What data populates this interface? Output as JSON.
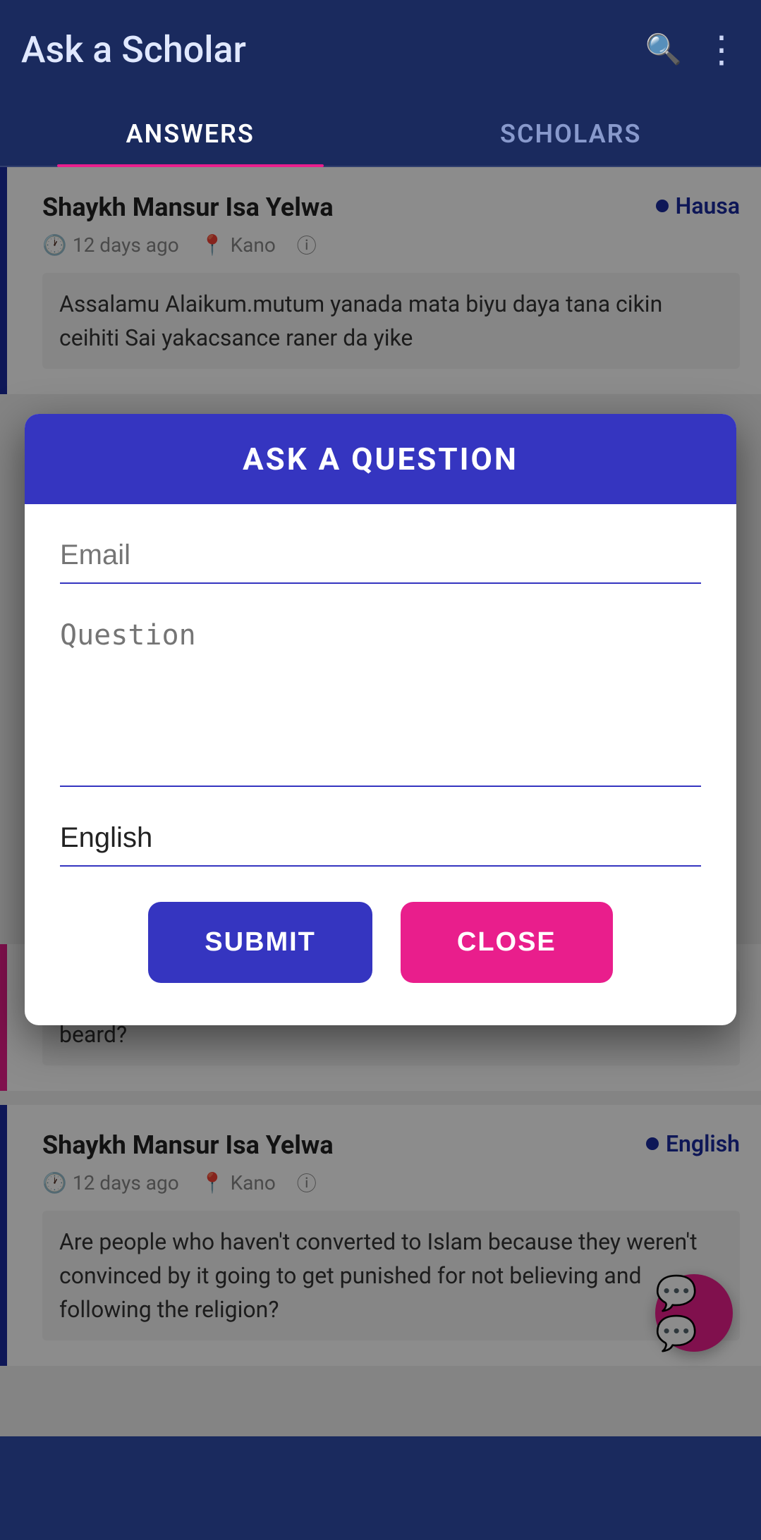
{
  "header": {
    "title": "Ask a Scholar",
    "search_icon": "search-icon",
    "menu_icon": "more-options-icon"
  },
  "tabs": [
    {
      "label": "ANSWERS",
      "active": true
    },
    {
      "label": "SCHOLARS",
      "active": false
    }
  ],
  "cards": [
    {
      "author": "Shaykh Mansur Isa Yelwa",
      "language": "Hausa",
      "time": "12 days ago",
      "location": "Kano",
      "body": "Assalamu Alaikum.mutum yanada mata biyu daya tana cikin ceihiti Sai yakacsance raner da yike",
      "border_color": "blue"
    },
    {
      "author": "",
      "language": "",
      "time": "",
      "location": "",
      "body": "Salaam Alaikum. Is it permissible for a young man to dye his black beard?",
      "border_color": "pink"
    },
    {
      "author": "Shaykh Mansur Isa Yelwa",
      "language": "English",
      "time": "12 days ago",
      "location": "Kano",
      "body": "Are people who haven't converted to Islam because they weren't convinced by it going to get punished for not believing and following the religion?",
      "border_color": "blue"
    }
  ],
  "modal": {
    "title": "ASK A QUESTION",
    "email_placeholder": "Email",
    "question_placeholder": "Question",
    "language_value": "English",
    "submit_label": "SUBMIT",
    "close_label": "CLOSE"
  },
  "fab": {
    "icon": "chat-icon"
  }
}
